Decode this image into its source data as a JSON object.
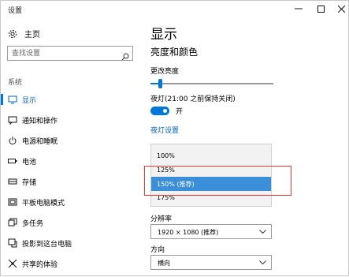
{
  "window": {
    "title": "设置",
    "controls": {
      "minimize": "minimize-icon",
      "maximize": "maximize-icon",
      "close": "close-icon"
    }
  },
  "sidebar": {
    "home_label": "主页",
    "search_placeholder": "查找设置",
    "section_label": "系统",
    "items": [
      {
        "label": "显示",
        "icon": "monitor-icon",
        "active": true
      },
      {
        "label": "通知和操作",
        "icon": "notification-icon",
        "active": false
      },
      {
        "label": "电源和睡眠",
        "icon": "power-icon",
        "active": false
      },
      {
        "label": "电池",
        "icon": "battery-icon",
        "active": false
      },
      {
        "label": "存储",
        "icon": "storage-icon",
        "active": false
      },
      {
        "label": "平板电脑模式",
        "icon": "tablet-icon",
        "active": false
      },
      {
        "label": "多任务",
        "icon": "multitask-icon",
        "active": false
      },
      {
        "label": "投影到这台电脑",
        "icon": "project-icon",
        "active": false
      },
      {
        "label": "共享的体验",
        "icon": "share-icon",
        "active": false
      }
    ]
  },
  "main": {
    "title": "显示",
    "section_title": "亮度和颜色",
    "brightness_label": "更改亮度",
    "brightness_level_percent": 8,
    "night_light_label": "夜灯(21:00 之前保持关闭)",
    "night_light_toggle": "开",
    "night_light_settings_link": "夜灯设置",
    "scale_options": [
      "100%",
      "125%",
      "150% (推荐)",
      "175%"
    ],
    "scale_selected_index": 2,
    "resolution_label": "分辨率",
    "resolution_value": "1920 × 1080 (推荐)",
    "orientation_label": "方向",
    "orientation_value": "横向"
  },
  "colors": {
    "accent": "#0078d7",
    "selection": "#3b8fd8",
    "annotation": "#e53935"
  }
}
